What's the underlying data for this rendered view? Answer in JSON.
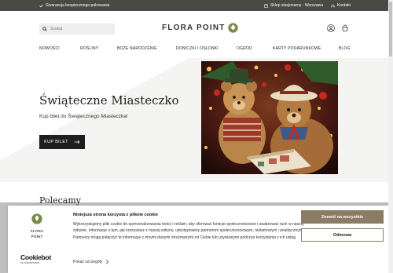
{
  "topbar": {
    "guarantee": "Gwarancja bezpiecznego pakowania",
    "store": "Sklep stacjonarny - Warszawa",
    "contact": "Kontakt"
  },
  "header": {
    "search_placeholder": "Szukaj",
    "logo_text": "FLORA POINT"
  },
  "nav": {
    "items": [
      "NOWOŚCI",
      "ROŚLINY",
      "BOŻE NARODZENIE",
      "DONICZKI I OSŁONKI",
      "OGRÓD",
      "KARTY PODARUNKOWE",
      "BLOG"
    ]
  },
  "hero": {
    "title": "Świąteczne Miasteczko",
    "subtitle": "Kup bilet do Świątecznego Miasteczka!",
    "button": "KUP BILET"
  },
  "section": {
    "title": "Polecamy"
  },
  "cookie": {
    "logo_line1": "FLORA",
    "logo_line2": "POINT",
    "brand": "Cookiebot",
    "brand_sub": "by Usercentrics",
    "title": "Niniejsza strona korzysta z plików cookie",
    "text": "Wykorzystujemy pliki cookie do spersonalizowania treści i reklam, aby oferować funkcje społecznościowe i analizować ruch w naszej witrynie. Informacje o tym, jak korzystasz z naszej witryny, udostępniamy partnerom społecznościowym, reklamowym i analitycznym. Partnerzy mogą połączyć te informacje z innymi danymi otrzymanymi od Ciebie lub uzyskanymi podczas korzystania z ich usług.",
    "more": "Pokaż szczegóły",
    "accept": "Zezwól na wszystkie",
    "reject": "Odmowa"
  },
  "colors": {
    "topbar": "#4a4a45",
    "accent": "#8b7d63",
    "logo_green": "#7a8a4a"
  }
}
